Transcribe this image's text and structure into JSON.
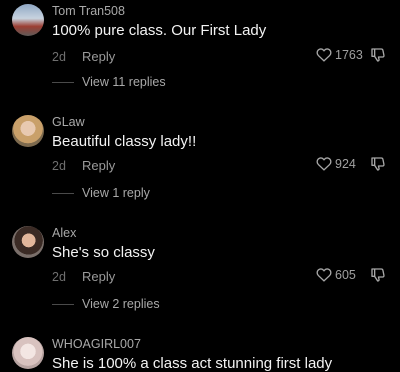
{
  "comments": [
    {
      "username": "Tom Tran508",
      "text": "100% pure class. Our First Lady",
      "age": "2d",
      "reply": "Reply",
      "likes": "1763",
      "view_replies": "View 11 replies"
    },
    {
      "username": "GLaw",
      "text": "Beautiful classy lady!!",
      "age": "2d",
      "reply": "Reply",
      "likes": "924",
      "view_replies": "View 1 reply"
    },
    {
      "username": "Alex",
      "text": "She's so classy",
      "age": "2d",
      "reply": "Reply",
      "likes": "605",
      "view_replies": "View 2 replies"
    },
    {
      "username": "WHOAGIRL007",
      "text": "She is 100% a class act stunning first lady"
    }
  ],
  "icons": {
    "like": "heart-outline-icon",
    "dislike": "thumb-down-outline-icon"
  },
  "colors": {
    "background": "#000000",
    "primary_text": "#f3f3f3",
    "secondary_text": "#a9a9a9"
  }
}
